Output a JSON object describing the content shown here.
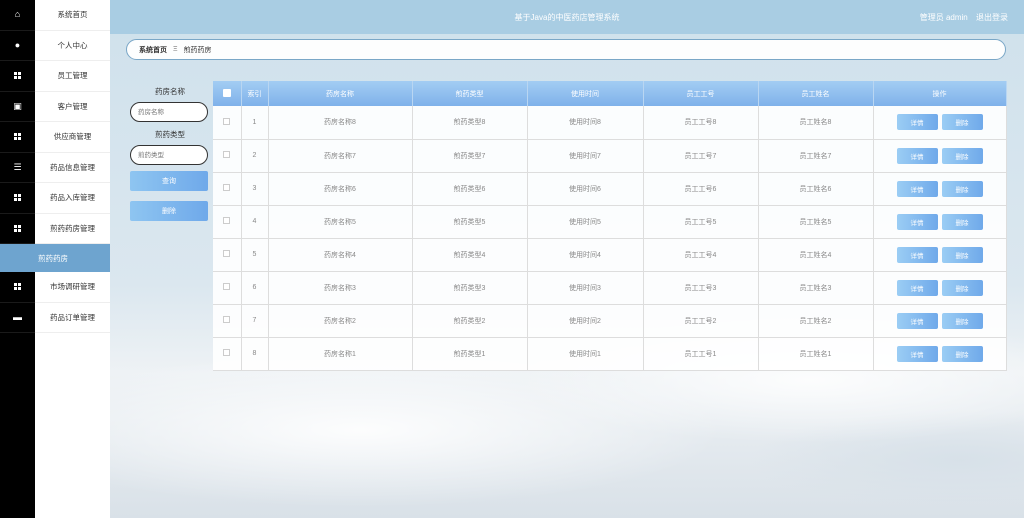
{
  "header": {
    "title": "基于Java的中医药店管理系统",
    "user_label": "管理员 admin",
    "logout_label": "退出登录"
  },
  "sidebar": {
    "items": [
      {
        "label": "系统首页",
        "icon": "home-icon"
      },
      {
        "label": "个人中心",
        "icon": "user-icon"
      },
      {
        "label": "员工管理",
        "icon": "grid-icon"
      },
      {
        "label": "客户管理",
        "icon": "clipboard-icon"
      },
      {
        "label": "供应商管理",
        "icon": "grid-icon"
      },
      {
        "label": "药品信息管理",
        "icon": "list-icon"
      },
      {
        "label": "药品入库管理",
        "icon": "grid-icon"
      },
      {
        "label": "煎药药房管理",
        "icon": "grid-icon"
      }
    ],
    "active_label": "煎药药房",
    "items_after": [
      {
        "label": "市场调研管理",
        "icon": "grid-icon"
      },
      {
        "label": "药品订单管理",
        "icon": "monitor-icon"
      }
    ]
  },
  "breadcrumb": {
    "home": "系统首页",
    "separator": "Ξ",
    "current": "煎药药房"
  },
  "search": {
    "name_label": "药房名称",
    "name_placeholder": "药房名称",
    "type_label": "煎药类型",
    "type_placeholder": "煎药类型",
    "query_button": "查询",
    "delete_button": "删除"
  },
  "table": {
    "columns": [
      "索引",
      "药房名称",
      "煎药类型",
      "使用时间",
      "员工工号",
      "员工姓名",
      "操作"
    ],
    "detail_label": "详情",
    "delete_label": "删除",
    "rows": [
      {
        "index": "1",
        "name": "药房名称8",
        "type": "煎药类型8",
        "time": "使用时间8",
        "emp_no": "员工工号8",
        "emp_name": "员工姓名8"
      },
      {
        "index": "2",
        "name": "药房名称7",
        "type": "煎药类型7",
        "time": "使用时间7",
        "emp_no": "员工工号7",
        "emp_name": "员工姓名7"
      },
      {
        "index": "3",
        "name": "药房名称6",
        "type": "煎药类型6",
        "time": "使用时间6",
        "emp_no": "员工工号6",
        "emp_name": "员工姓名6"
      },
      {
        "index": "4",
        "name": "药房名称5",
        "type": "煎药类型5",
        "time": "使用时间5",
        "emp_no": "员工工号5",
        "emp_name": "员工姓名5"
      },
      {
        "index": "5",
        "name": "药房名称4",
        "type": "煎药类型4",
        "time": "使用时间4",
        "emp_no": "员工工号4",
        "emp_name": "员工姓名4"
      },
      {
        "index": "6",
        "name": "药房名称3",
        "type": "煎药类型3",
        "time": "使用时间3",
        "emp_no": "员工工号3",
        "emp_name": "员工姓名3"
      },
      {
        "index": "7",
        "name": "药房名称2",
        "type": "煎药类型2",
        "time": "使用时间2",
        "emp_no": "员工工号2",
        "emp_name": "员工姓名2"
      },
      {
        "index": "8",
        "name": "药房名称1",
        "type": "煎药类型1",
        "time": "使用时间1",
        "emp_no": "员工工号1",
        "emp_name": "员工姓名1"
      }
    ]
  },
  "colors": {
    "header_bg": "#a9cde3",
    "active_menu_bg": "#6ea4cf",
    "table_header": "#7fb1ea",
    "button": "#6fa9ea"
  }
}
